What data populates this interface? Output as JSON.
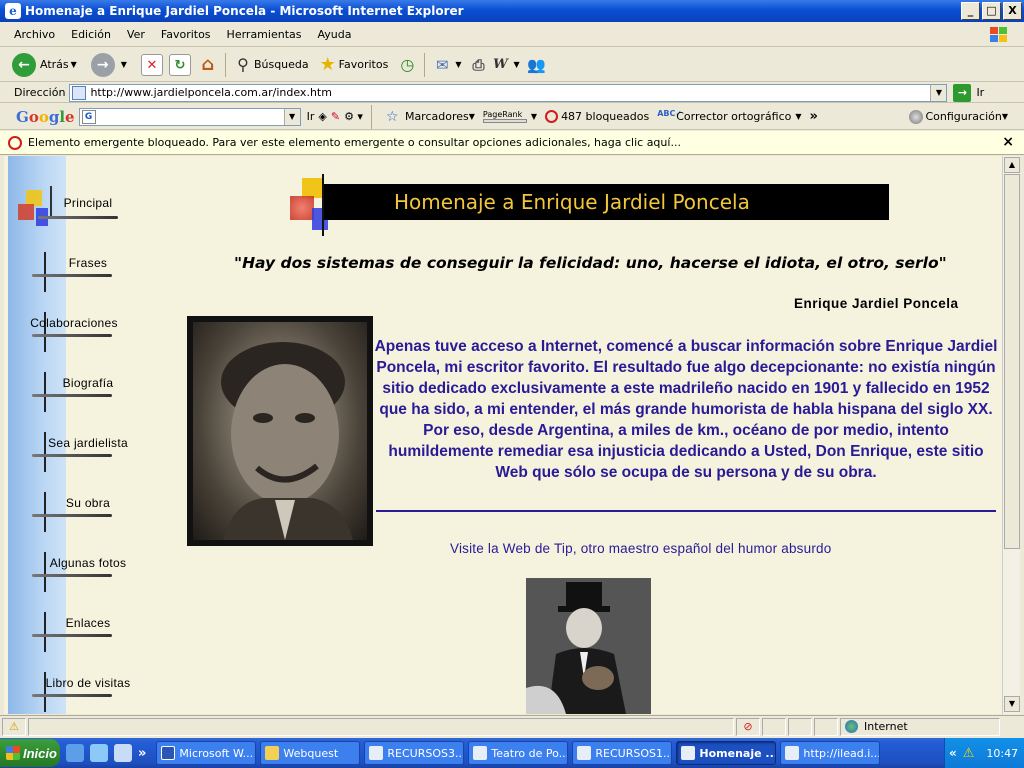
{
  "window": {
    "title": "Homenaje a Enrique Jardiel Poncela - Microsoft Internet Explorer",
    "minimize": "_",
    "maximize": "□",
    "close": "X"
  },
  "menu": [
    "Archivo",
    "Edición",
    "Ver",
    "Favoritos",
    "Herramientas",
    "Ayuda"
  ],
  "toolbar": {
    "back": "Atrás",
    "search": "Búsqueda",
    "favorites": "Favoritos"
  },
  "address": {
    "label": "Dirección",
    "url": "http://www.jardielponcela.com.ar/index.htm",
    "go": "Ir"
  },
  "google": {
    "logo": "Google",
    "go": "Ir",
    "bookmarks": "Marcadores",
    "pagerank": "PageRank",
    "blocked": "487 bloqueados",
    "spell": "Corrector ortográfico",
    "more": "»",
    "settings": "Configuración"
  },
  "popup": {
    "message": "Elemento emergente bloqueado.  Para ver este elemento emergente o consultar opciones adicionales, haga clic aquí...",
    "close": "×"
  },
  "nav": [
    "Principal",
    "Frases",
    "Colaboraciones",
    "Biografía",
    "Sea jardielista",
    "Su obra",
    "Algunas fotos",
    "Enlaces",
    "Libro de visitas"
  ],
  "page": {
    "header": "Homenaje a Enrique Jardiel Poncela",
    "quote": "\"Hay dos sistemas de conseguir la felicidad: uno, hacerse el idiota, el otro, serlo\"",
    "author": "Enrique Jardiel Poncela",
    "intro": "Apenas tuve acceso a Internet, comencé a buscar  información sobre Enrique Jardiel Poncela,  mi escritor favorito. El resultado fue algo decepcionante: no existía ningún sitio dedicado exclusivamente a este  madrileño nacido en 1901 y fallecido en 1952 que ha sido, a mi entender, el más grande humorista de habla hispana del siglo XX. Por eso, desde Argentina, a miles de km., océano de por medio, intento humildemente remediar  esa injusticia dedicando a Usted, Don Enrique, este sitio Web  que sólo se ocupa de su persona y de su obra.",
    "tip_link": "Visite la Web de Tip, otro maestro español del humor absurdo"
  },
  "status": {
    "zone": "Internet"
  },
  "taskbar": {
    "start": "Inicio",
    "more": "»",
    "tasks": [
      {
        "label": "Microsoft W...",
        "active": false
      },
      {
        "label": "Webquest",
        "active": false
      },
      {
        "label": "RECURSOS3...",
        "active": false
      },
      {
        "label": "Teatro de Po...",
        "active": false
      },
      {
        "label": "RECURSOS1...",
        "active": false
      },
      {
        "label": "Homenaje ...",
        "active": true
      },
      {
        "label": "http://ilead.i...",
        "active": false
      }
    ],
    "tray_expand": "«",
    "clock": "10:47"
  }
}
